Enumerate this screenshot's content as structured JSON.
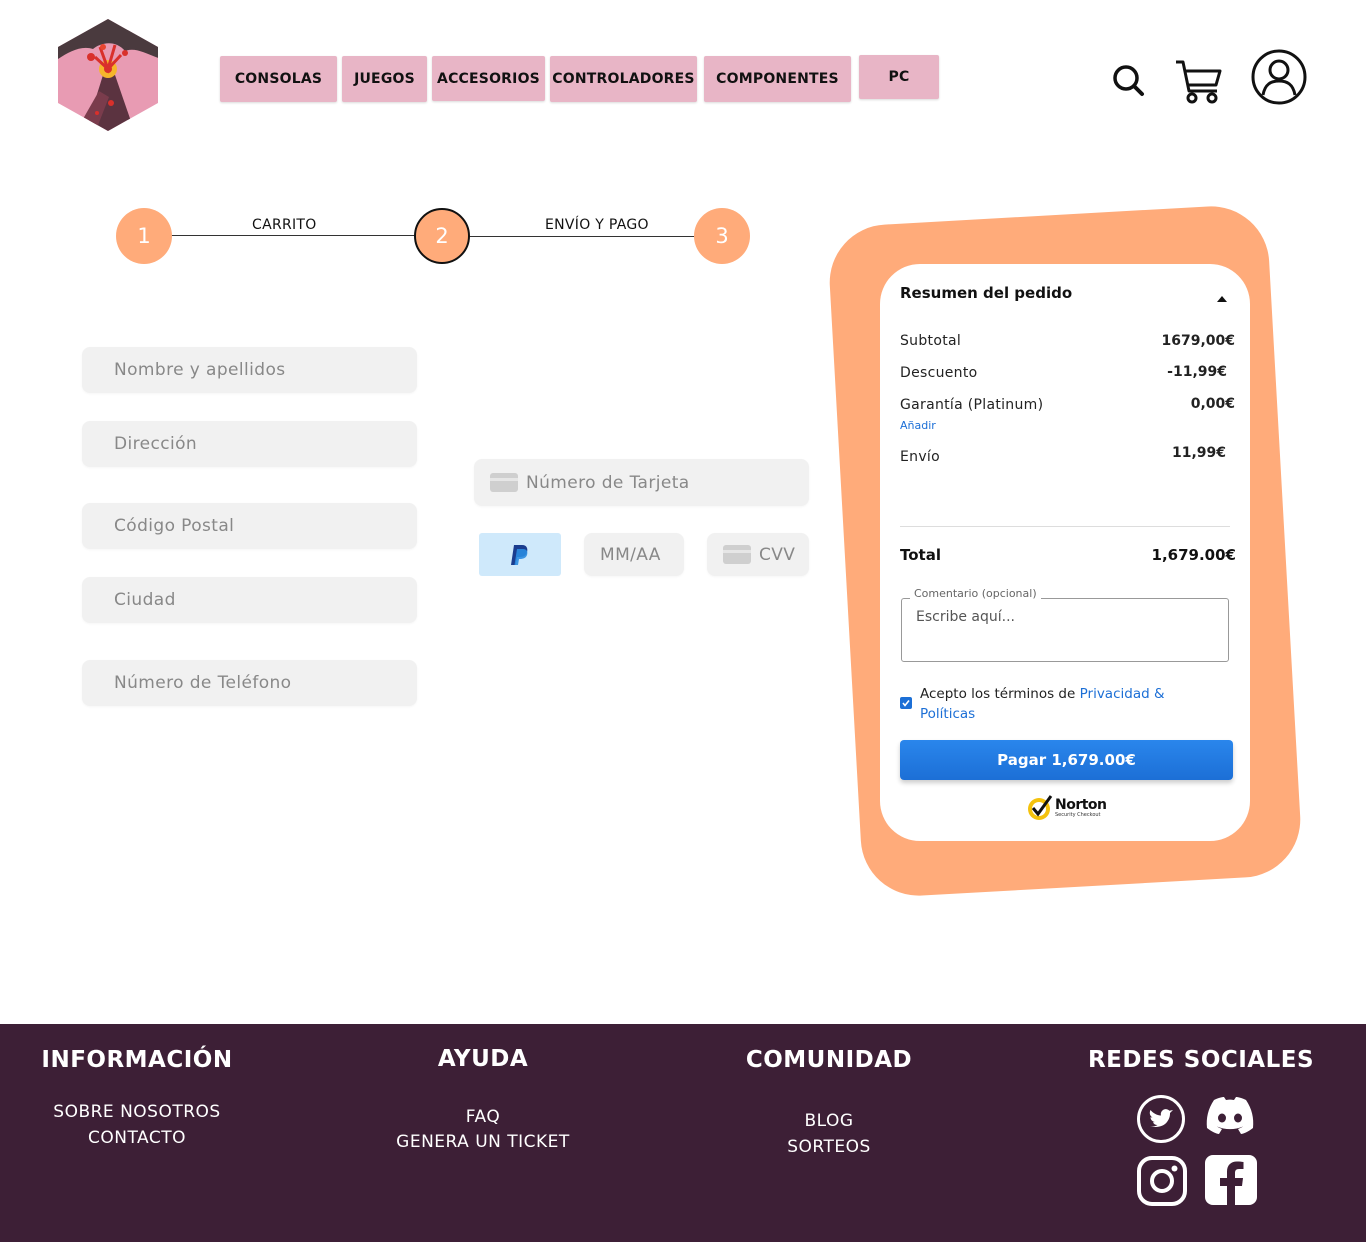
{
  "nav": {
    "items": [
      "CONSOLAS",
      "JUEGOS",
      "ACCESORIOS",
      "CONTROLADORES",
      "COMPONENTES",
      "PC"
    ]
  },
  "header_icons": [
    "search-icon",
    "cart-icon",
    "user-icon"
  ],
  "steps": [
    {
      "number": "1",
      "label": "CARRITO"
    },
    {
      "number": "2",
      "label": "ENVÍO Y PAGO"
    },
    {
      "number": "3",
      "label": ""
    }
  ],
  "form": {
    "name_placeholder": "Nombre y apellidos",
    "address_placeholder": "Dirección",
    "postal_placeholder": "Código Postal",
    "city_placeholder": "Ciudad",
    "phone_placeholder": "Número de Teléfono",
    "card_number_placeholder": "Número de Tarjeta",
    "expiry_placeholder": "MM/AA",
    "cvv_placeholder": "CVV"
  },
  "summary": {
    "title": "Resumen del pedido",
    "subtotal_label": "Subtotal",
    "subtotal_value": "1679,00€",
    "discount_label": "Descuento",
    "discount_value": "-11,99€",
    "warranty_label": "Garantía (Platinum)",
    "warranty_value": "0,00€",
    "warranty_add": "Añadir",
    "shipping_label": "Envío",
    "shipping_value": "11,99€",
    "total_label": "Total",
    "total_value": "1,679.00€",
    "comment_legend": "Comentario (opcional)",
    "comment_placeholder": "Escribe aquí...",
    "terms_text": "Acepto los términos de ",
    "terms_link": "Privacidad & Políticas",
    "terms_checked": true,
    "pay_button": "Pagar 1,679.00€",
    "norton_brand": "Norton",
    "norton_sub": "Security Checkout"
  },
  "footer": {
    "info_title": "INFORMACIÓN",
    "info_links": [
      "SOBRE NOSOTROS",
      "CONTACTO"
    ],
    "help_title": "AYUDA",
    "help_links": [
      "FAQ",
      "GENERA UN TICKET"
    ],
    "community_title": "COMUNIDAD",
    "community_links": [
      "BLOG",
      "SORTEOS"
    ],
    "social_title": "REDES SOCIALES",
    "social_icons": [
      "twitter-icon",
      "discord-icon",
      "instagram-icon",
      "facebook-icon"
    ]
  },
  "colors": {
    "nav_bg": "#e8b5c6",
    "step_accent": "#ffab7a",
    "pay_button": "#1c6fd6",
    "footer_bg": "#3d1f36",
    "link": "#1c6fd6"
  }
}
